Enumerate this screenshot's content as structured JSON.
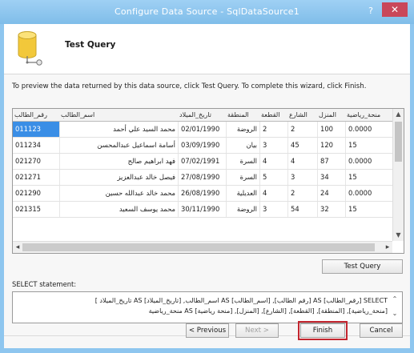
{
  "window": {
    "title": "Configure Data Source - SqlDataSource1",
    "help_label": "?",
    "close_label": "✕"
  },
  "header": {
    "heading": "Test Query",
    "icon": "database-icon"
  },
  "info_text": "To preview the data returned by this data source, click Test Query. To complete this wizard, click Finish.",
  "grid": {
    "columns": [
      "رقم_الطالب",
      "اسم_الطالب",
      "تاريخ_الميلاد",
      "المنطقة",
      "القطعة",
      "الشارع",
      "المنزل",
      "منحة_رياضية"
    ],
    "rows": [
      [
        "011123",
        "محمد السيد علي أحمد",
        "02/01/1990",
        "الروضة",
        "2",
        "2",
        "100",
        "0.0000"
      ],
      [
        "011234",
        "أسامة اسماعيل عبدالمحسن",
        "03/09/1990",
        "بيان",
        "3",
        "45",
        "120",
        "15"
      ],
      [
        "021270",
        "فهد ابراهيم صالح",
        "07/02/1991",
        "السرة",
        "4",
        "4",
        "87",
        "0.0000"
      ],
      [
        "021271",
        "فيصل خالد عبدالعزيز",
        "27/08/1990",
        "السرة",
        "5",
        "3",
        "34",
        "15"
      ],
      [
        "021290",
        "محمد خالد عبدالله حسين",
        "26/08/1990",
        "العديلية",
        "4",
        "2",
        "24",
        "0.0000"
      ],
      [
        "021315",
        "محمد يوسف السعيد",
        "30/11/1990",
        "الروضة",
        "3",
        "54",
        "32",
        "15"
      ]
    ],
    "selected_row_index": 0
  },
  "buttons": {
    "test_query": "Test Query",
    "previous": "< Previous",
    "next": "Next >",
    "finish": "Finish",
    "cancel": "Cancel"
  },
  "select_statement": {
    "label": "SELECT statement:",
    "line1": "SELECT [رقم_الطالب] AS [رقم الطالب], [اسم_الطالب] AS اسم_الطالب, [تاريخ_الميلاد] AS تاريخ_الميلاد ]",
    "line2": "[منحة_رياضية], [المنطقة], [القطعة], [الشارع], [المنزل], [منحة رياضية] AS منحة_رياضية"
  },
  "colors": {
    "titlebar": "#8ec6ef",
    "close": "#c9475a",
    "selection": "#3a8ee6",
    "finish_highlight": "#c3262f"
  }
}
